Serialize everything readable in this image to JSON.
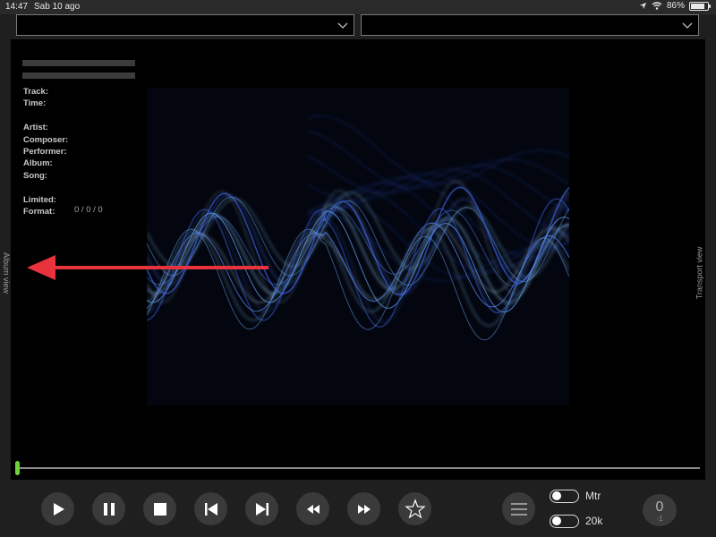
{
  "status_bar": {
    "time": "14:47",
    "date": "Sab 10 ago",
    "battery": "86%",
    "battery_level": 0.86
  },
  "dropdowns": {
    "left_value": "",
    "right_value": ""
  },
  "info": {
    "track": "Track:",
    "time": "Time:",
    "artist": "Artist:",
    "composer": "Composer:",
    "performer": "Performer:",
    "album": "Album:",
    "song": "Song:",
    "limited": "Limited:",
    "format": "Format:",
    "format_value": "0 / 0 / 0"
  },
  "side_labels": {
    "left": "Album view",
    "right": "Transport view"
  },
  "playback": {
    "progress": 0
  },
  "controls": {
    "toggle1_label": "Mtr",
    "toggle2_label": "20k",
    "counter_main": "0",
    "counter_sub": "-1",
    "icons": [
      "play-icon",
      "pause-icon",
      "stop-icon",
      "previous-icon",
      "next-icon",
      "rewind-icon",
      "fast-forward-icon",
      "star-icon",
      "menu-icon"
    ]
  },
  "colors": {
    "accent": "#6dd13a",
    "arrow": "#e8323c",
    "wave": "#4f7dff"
  }
}
